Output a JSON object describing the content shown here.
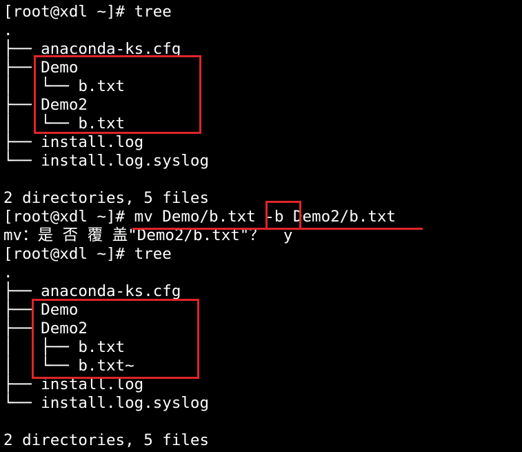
{
  "terminal": {
    "lines": [
      "[root@xdl ~]# tree",
      ".",
      "├── anaconda-ks.cfg",
      "├── Demo",
      "│   └── b.txt",
      "├── Demo2",
      "│   └── b.txt",
      "├── install.log",
      "└── install.log.syslog",
      "",
      "2 directories, 5 files",
      "",
      "mv：是 否 覆 盖\"Demo2/b.txt\"？  y",
      "[root@xdl ~]# tree",
      ".",
      "├── anaconda-ks.cfg",
      "├── Demo",
      "├── Demo2",
      "│   ├── b.txt",
      "│   └── b.txt~",
      "├── install.log",
      "└── install.log.syslog",
      "",
      "2 directories, 5 files"
    ],
    "command_line": {
      "prompt": "[root@xdl ~]# ",
      "command_start": "mv Demo/b.txt ",
      "flag": "-b",
      "command_end": " Demo2/b.txt"
    }
  },
  "colors": {
    "background": "#000000",
    "text": "#ffffff",
    "annotation": "#e0242a"
  }
}
